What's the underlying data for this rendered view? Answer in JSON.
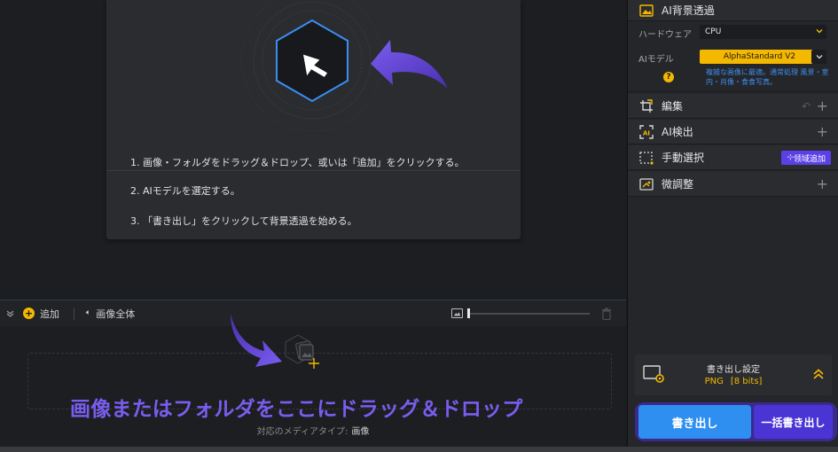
{
  "steps": {
    "step1": "1. 画像・フォルダをドラッグ＆ドロップ、或いは「追加」をクリックする。",
    "step2": "2. AIモデルを選定する。",
    "step3": "3. 「書き出し」をクリックして背景透過を始める。"
  },
  "toolbar": {
    "add_label": "追加",
    "fit_label": "画像全体",
    "zoom_level": 0.01
  },
  "dropzone": {
    "text": "画像またはフォルダをここにドラッグ＆ドロップ",
    "media_types_label": "対応のメディアタイプ:",
    "media_types_value": "画像"
  },
  "panel": {
    "ai_section": {
      "title": "AI背景透過",
      "hardware_label": "ハードウェア",
      "hardware_value": "CPU",
      "model_label": "AIモデル",
      "model_value": "AlphaStandard  V2",
      "model_description": "複雑な画像に最適。通常処理 風景・室内・肖像・食食写真。"
    },
    "edit_title": "編集",
    "detect_title": "AI検出",
    "manual_title": "手動選択",
    "area_add_label": "领域追加",
    "area_add_prefix": "⊹",
    "fine_title": "微調整"
  },
  "export": {
    "settings_title": "書き出し設定",
    "format": "PNG",
    "bits": "[8 bits]",
    "export_label": "書き出し",
    "batch_label": "一括書き出し"
  },
  "colors": {
    "accent_yellow": "#f5b800",
    "accent_blue": "#2e8ff0",
    "accent_purple": "#5b40e6",
    "hint_purple": "#7a5df0"
  }
}
